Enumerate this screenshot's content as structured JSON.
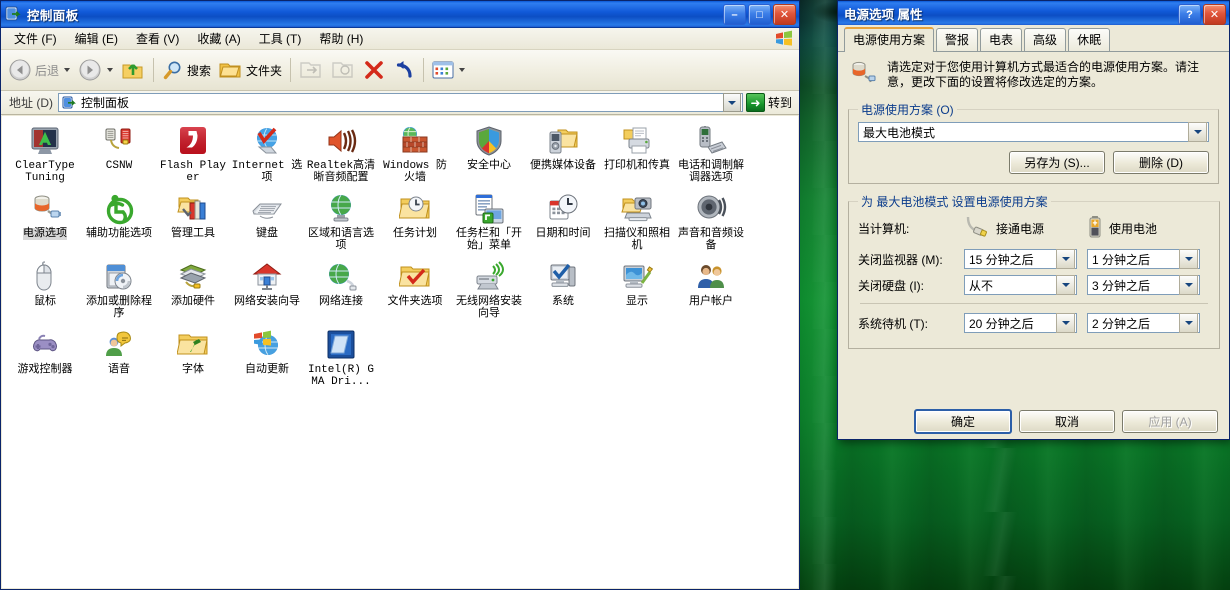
{
  "explorer": {
    "title": "控制面板",
    "title_icon": "control-panel-icon",
    "menu": [
      "文件 (F)",
      "编辑 (E)",
      "查看 (V)",
      "收藏 (A)",
      "工具 (T)",
      "帮助 (H)"
    ],
    "window_buttons": {
      "minimize": "–",
      "maximize": "□",
      "close": "✕"
    },
    "toolbar": {
      "back": "后退",
      "forward": "",
      "up": "",
      "search": "搜索",
      "folders": "文件夹",
      "move_to": "",
      "copy_to": "",
      "delete": "",
      "undo": "",
      "views": ""
    },
    "address": {
      "label": "地址 (D)",
      "value": "控制面板",
      "go_label": "转到"
    },
    "items": [
      {
        "label": "ClearType Tuning",
        "icon": "cleartype-icon",
        "selected": false
      },
      {
        "label": "CSNW",
        "icon": "csnw-icon",
        "selected": false
      },
      {
        "label": "Flash Player",
        "icon": "flash-player-icon",
        "selected": false
      },
      {
        "label": "Internet 选项",
        "icon": "internet-options-icon",
        "selected": false
      },
      {
        "label": "Realtek高清晰音频配置",
        "icon": "realtek-audio-icon",
        "selected": false
      },
      {
        "label": "Windows 防火墙",
        "icon": "windows-firewall-icon",
        "selected": false
      },
      {
        "label": "安全中心",
        "icon": "security-center-icon",
        "selected": false
      },
      {
        "label": "便携媒体设备",
        "icon": "portable-media-icon",
        "selected": false
      },
      {
        "label": "打印机和传真",
        "icon": "printers-faxes-icon",
        "selected": false
      },
      {
        "label": "电话和调制解调器选项",
        "icon": "phone-modem-icon",
        "selected": false
      },
      {
        "label": "电源选项",
        "icon": "power-options-icon",
        "selected": true
      },
      {
        "label": "辅助功能选项",
        "icon": "accessibility-icon",
        "selected": false
      },
      {
        "label": "管理工具",
        "icon": "admin-tools-icon",
        "selected": false
      },
      {
        "label": "键盘",
        "icon": "keyboard-icon",
        "selected": false
      },
      {
        "label": "区域和语言选项",
        "icon": "regional-options-icon",
        "selected": false
      },
      {
        "label": "任务计划",
        "icon": "scheduled-tasks-icon",
        "selected": false
      },
      {
        "label": "任务栏和「开始」菜单",
        "icon": "taskbar-startmenu-icon",
        "selected": false
      },
      {
        "label": "日期和时间",
        "icon": "date-time-icon",
        "selected": false
      },
      {
        "label": "扫描仪和照相机",
        "icon": "scanners-cameras-icon",
        "selected": false
      },
      {
        "label": "声音和音频设备",
        "icon": "sounds-audio-icon",
        "selected": false
      },
      {
        "label": "鼠标",
        "icon": "mouse-icon",
        "selected": false
      },
      {
        "label": "添加或删除程序",
        "icon": "add-remove-programs-icon",
        "selected": false
      },
      {
        "label": "添加硬件",
        "icon": "add-hardware-icon",
        "selected": false
      },
      {
        "label": "网络安装向导",
        "icon": "network-setup-wizard-icon",
        "selected": false
      },
      {
        "label": "网络连接",
        "icon": "network-connections-icon",
        "selected": false
      },
      {
        "label": "文件夹选项",
        "icon": "folder-options-icon",
        "selected": false
      },
      {
        "label": "无线网络安装向导",
        "icon": "wireless-network-wizard-icon",
        "selected": false
      },
      {
        "label": "系统",
        "icon": "system-icon",
        "selected": false
      },
      {
        "label": "显示",
        "icon": "display-icon",
        "selected": false
      },
      {
        "label": "用户帐户",
        "icon": "user-accounts-icon",
        "selected": false
      },
      {
        "label": "游戏控制器",
        "icon": "game-controllers-icon",
        "selected": false
      },
      {
        "label": "语音",
        "icon": "speech-icon",
        "selected": false
      },
      {
        "label": "字体",
        "icon": "fonts-icon",
        "selected": false
      },
      {
        "label": "自动更新",
        "icon": "automatic-updates-icon",
        "selected": false
      },
      {
        "label": "Intel(R) GMA Dri...",
        "icon": "intel-gma-driver-icon",
        "selected": false
      }
    ]
  },
  "dialog": {
    "title": "电源选项 属性",
    "help_button": "?",
    "close_button": "✕",
    "tabs": [
      {
        "label": "电源使用方案",
        "active": true
      },
      {
        "label": "警报",
        "active": false
      },
      {
        "label": "电表",
        "active": false
      },
      {
        "label": "高级",
        "active": false
      },
      {
        "label": "休眠",
        "active": false
      }
    ],
    "intro_icon": "power-scheme-icon",
    "intro_text": "请选定对于您使用计算机方式最适合的电源使用方案。请注意，更改下面的设置将修改选定的方案。",
    "scheme_group_legend": "电源使用方案 (O)",
    "scheme_value": "最大电池模式",
    "save_as_button": "另存为 (S)...",
    "delete_button": "删除 (D)",
    "settings_legend": "为 最大电池模式 设置电源使用方案",
    "when_computer_label": "当计算机:",
    "column_ac": "接通电源",
    "column_dc": "使用电池",
    "ac_icon": "power-plug-icon",
    "dc_icon": "battery-icon",
    "rows": [
      {
        "label": "关闭监视器 (M):",
        "ac": "15 分钟之后",
        "dc": "1 分钟之后"
      },
      {
        "label": "关闭硬盘 (I):",
        "ac": "从不",
        "dc": "3 分钟之后"
      },
      {
        "label": "系统待机 (T):",
        "ac": "20 分钟之后",
        "dc": "2 分钟之后"
      }
    ],
    "ok_button": "确定",
    "cancel_button": "取消",
    "apply_button": "应用 (A)",
    "apply_disabled": true
  },
  "colors": {
    "titlebar_blue": "#0c4ec4",
    "dialog_face": "#ece9d8",
    "active_tab_accent": "#e8a33d",
    "selection_gray": "#d8d8d8",
    "go_green": "#17962b",
    "desktop_green": "#0d8a2d"
  }
}
